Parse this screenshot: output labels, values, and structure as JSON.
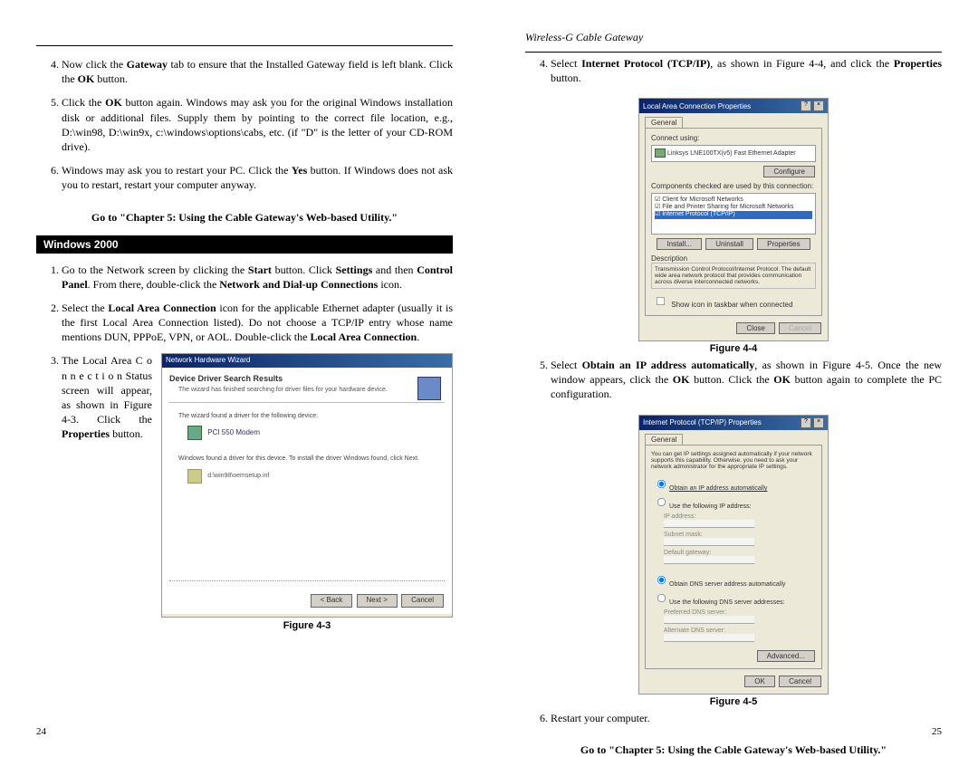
{
  "left": {
    "steps_a": [
      {
        "n": "4.",
        "pre": "Now click the ",
        "b1": "Gateway",
        "mid": " tab to ensure that the Installed Gateway field is left blank. Click the ",
        "b2": "OK",
        "post": " button."
      },
      {
        "n": "5.",
        "text_parts": [
          "Click the ",
          "OK",
          " button again.  Windows may ask you for the original Windows installation disk or additional files. Supply them by pointing to the correct file location, e.g., D:\\win98, D:\\win9x, c:\\windows\\options\\cabs, etc. (if \"D\" is the letter of your CD-ROM drive)."
        ]
      },
      {
        "n": "6.",
        "text_parts": [
          "Windows may ask you to restart your PC. Click the ",
          "Yes",
          " button. If Windows does not ask you to restart, restart your computer anyway."
        ]
      }
    ],
    "goto": "Go to \"Chapter 5: Using the Cable Gateway's Web-based Utility.\"",
    "section": "Windows 2000",
    "steps_b": [
      {
        "n": "1.",
        "parts": [
          "Go to the Network screen by clicking the ",
          "Start",
          " button. Click ",
          "Settings",
          " and then ",
          "Control Panel",
          ".  From there, double-click the ",
          "Network and Dial-up Connections",
          " icon."
        ]
      },
      {
        "n": "2.",
        "parts": [
          "Select the ",
          "Local Area Connection",
          " icon for the applicable Ethernet adapter (usually it is the first Local Area Connection listed). Do not choose a TCP/IP entry whose name mentions DUN, PPPoE, VPN, or AOL. Double-click the ",
          "Local Area Connection",
          "."
        ]
      }
    ],
    "step3_text_a": "The Local Area C o n n e c t i o n Status screen will appear, as shown in Figure 4-3. Click the ",
    "step3_bold": "Properties",
    "step3_text_b": " button.",
    "fig3_caption": "Figure 4-3",
    "fig3": {
      "title": "Network Hardware Wizard",
      "h": "Device Driver Search Results",
      "sub": "The wizard has finished searching for driver files for your hardware device.",
      "line1": "The wizard found a driver for the following device:",
      "dev": "PCI 550 Modem",
      "line2": "Windows found a driver for this device. To install the driver Windows found, click Next.",
      "path": "d:\\win98\\oemsetup.inf",
      "back": "< Back",
      "next": "Next >",
      "cancel": "Cancel"
    },
    "pagenum": "24"
  },
  "right": {
    "header": "Wireless-G Cable Gateway",
    "steps": [
      {
        "n": "4.",
        "parts": [
          "Select ",
          "Internet Protocol (TCP/IP)",
          ", as shown in Figure 4-4, and click the ",
          "Properties",
          " button."
        ]
      },
      {
        "n": "5.",
        "parts": [
          "Select ",
          "Obtain an IP address automatically",
          ", as shown in Figure 4-5. Once the new window appears, click the ",
          "OK",
          " button. Click the ",
          "OK",
          " button again to complete the PC configuration."
        ]
      },
      {
        "n": "6.",
        "parts": [
          "Restart your computer."
        ]
      }
    ],
    "goto": "Go to \"Chapter 5: Using the Cable Gateway's Web-based Utility.\"",
    "fig4_caption": "Figure 4-4",
    "fig5_caption": "Figure 4-5",
    "fig4": {
      "title": "Local Area Connection Properties",
      "tab": "General",
      "connect_using": "Connect using:",
      "adapter": "Linksys LNE100TX(v5) Fast Ethernet Adapter",
      "configure": "Configure",
      "comp_label": "Components checked are used by this connection:",
      "c1": "Client for Microsoft Networks",
      "c2": "File and Printer Sharing for Microsoft Networks",
      "c3": "Internet Protocol (TCP/IP)",
      "install": "Install...",
      "uninstall": "Uninstall",
      "properties": "Properties",
      "desc_label": "Description",
      "desc": "Transmission Control Protocol/Internet Protocol. The default wide area network protocol that provides communication across diverse interconnected networks.",
      "showicon": "Show icon in taskbar when connected",
      "close": "Close",
      "cancel": "Cancel"
    },
    "fig5": {
      "title": "Internet Protocol (TCP/IP) Properties",
      "tab": "General",
      "blurb": "You can get IP settings assigned automatically if your network supports this capability. Otherwise, you need to ask your network administrator for the appropriate IP settings.",
      "r1": "Obtain an IP address automatically",
      "r2": "Use the following IP address:",
      "ip": "IP address:",
      "mask": "Subnet mask:",
      "gw": "Default gateway:",
      "r3": "Obtain DNS server address automatically",
      "r4": "Use the following DNS server addresses:",
      "pdns": "Preferred DNS server:",
      "adns": "Alternate DNS server:",
      "adv": "Advanced...",
      "ok": "OK",
      "cancel": "Cancel"
    },
    "pagenum": "25"
  }
}
